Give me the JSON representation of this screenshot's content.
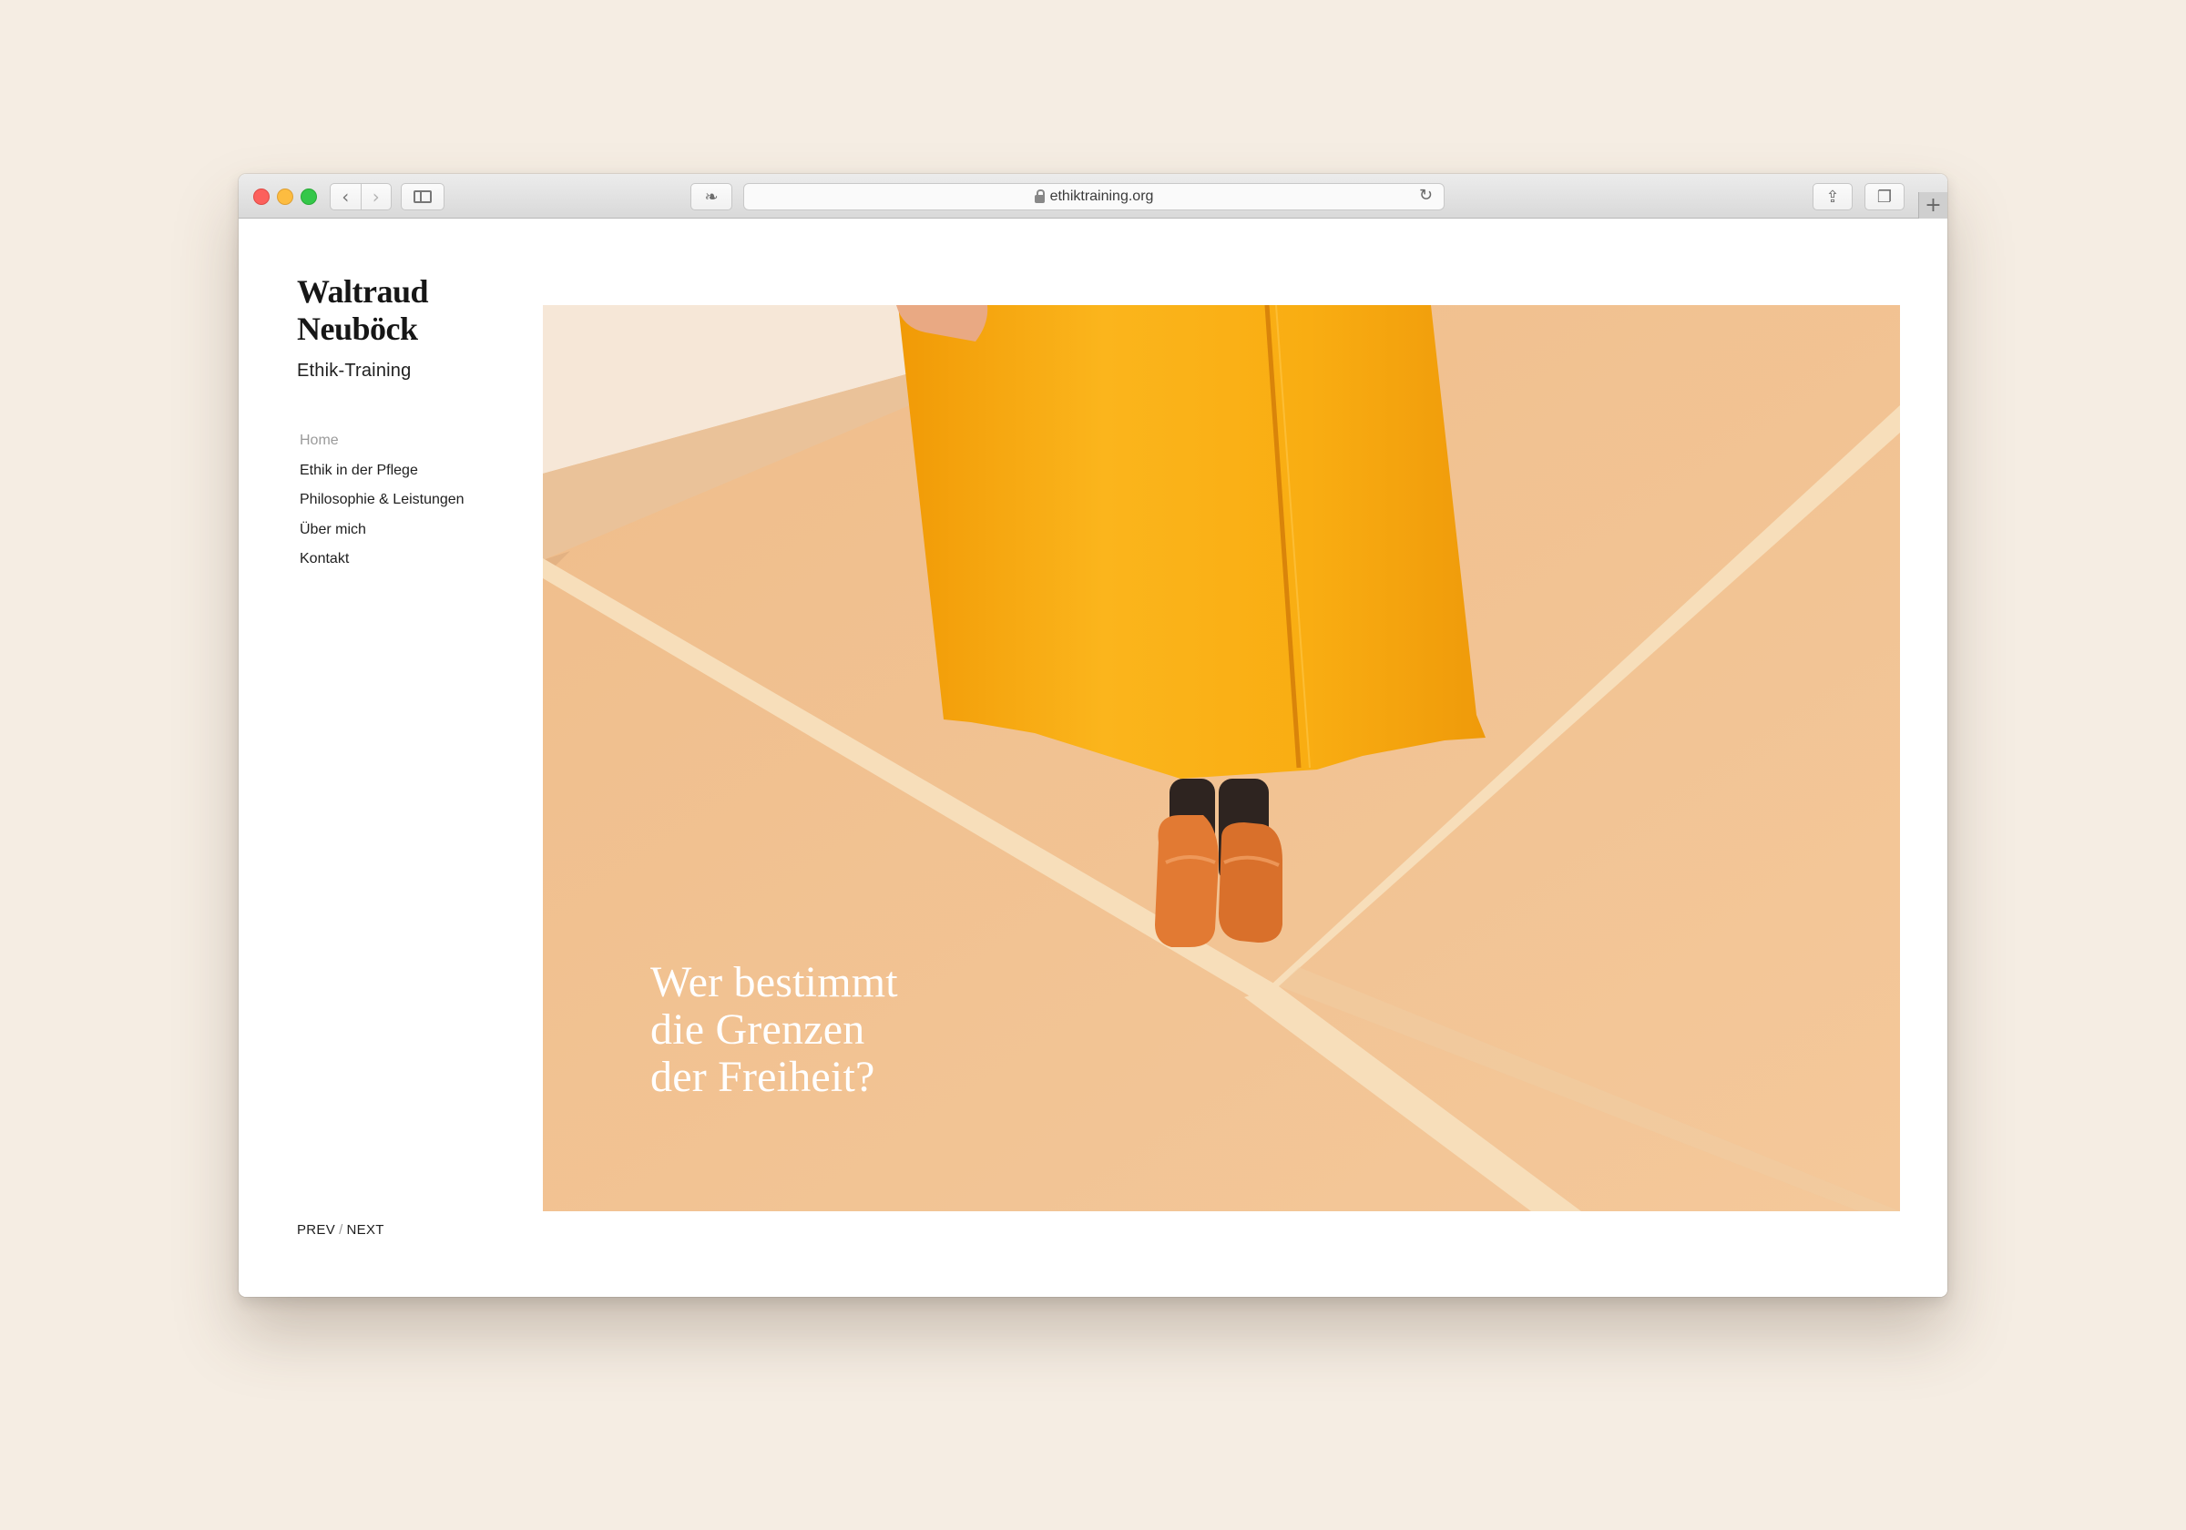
{
  "browser": {
    "url": "ethiktraining.org",
    "back_icon": "‹",
    "forward_icon": "›",
    "ext_icon": "❧",
    "reload_icon": "↻",
    "share_icon": "⇪",
    "tabs_icon": "❐",
    "newtab_icon": "+"
  },
  "site": {
    "name_line1": "Waltraud",
    "name_line2": "Neuböck",
    "subtitle": "Ethik-Training"
  },
  "nav": {
    "items": [
      {
        "label": "Home",
        "active": true
      },
      {
        "label": "Ethik in der Pflege"
      },
      {
        "label": "Philosophie & Leistungen"
      },
      {
        "label": "Über mich"
      },
      {
        "label": "Kontakt"
      }
    ]
  },
  "pager": {
    "prev": "PREV",
    "sep": "/",
    "next": "NEXT"
  },
  "hero": {
    "line1": "Wer bestimmt",
    "line2": "die Grenzen",
    "line3": "der Freiheit?"
  },
  "colors": {
    "floor": "#f2c293",
    "tape": "#f6dcb9",
    "coat": "#f8ad12",
    "shoes": "#e07a33"
  }
}
